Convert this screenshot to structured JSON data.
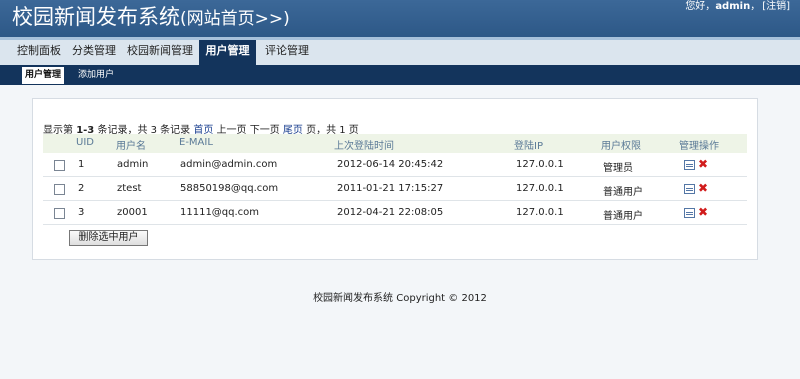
{
  "header": {
    "title": "校园新闻发布系统",
    "home_link": "(网站首页>>)",
    "greeting": "您好，",
    "username": "admin",
    "greeting_suffix": "，",
    "logout": "[注销]"
  },
  "nav": {
    "tabs": [
      {
        "label": "控制面板"
      },
      {
        "label": "分类管理"
      },
      {
        "label": "校园新闻管理"
      },
      {
        "label": "用户管理",
        "active": true
      },
      {
        "label": "评论管理"
      }
    ]
  },
  "subnav": {
    "tabs": [
      {
        "label": "用户管理",
        "active": true
      },
      {
        "label": "添加用户"
      }
    ]
  },
  "summary": {
    "prefix": "显示第 ",
    "range": "1-3",
    "middle": " 条记录，共 3 条记录 ",
    "first": "首页",
    "prev": " 上一页 下一页 ",
    "last": "尾页",
    "suffix": " 页，共 1 页"
  },
  "table": {
    "headers": [
      "UID",
      "用户名",
      "E-MAIL",
      "上次登陆时间",
      "登陆IP",
      "用户权限",
      "管理操作"
    ],
    "rows": [
      {
        "uid": "1",
        "username": "admin",
        "email": "admin@admin.com",
        "last_login": "2012-06-14 20:45:42",
        "ip": "127.0.0.1",
        "role": "管理员"
      },
      {
        "uid": "2",
        "username": "ztest",
        "email": "58850198@qq.com",
        "last_login": "2011-01-21 17:15:27",
        "ip": "127.0.0.1",
        "role": "普通用户"
      },
      {
        "uid": "3",
        "username": "z0001",
        "email": "11111@qq.com",
        "last_login": "2012-04-21 22:08:05",
        "ip": "127.0.0.1",
        "role": "普通用户"
      }
    ]
  },
  "actions": {
    "delete_selected": "删除选中用户"
  },
  "footer": {
    "copyright": "校园新闻发布系统 Copyright © 2012"
  },
  "colors": {
    "header_bg": "#2d5887",
    "nav_active_bg": "#13345c",
    "table_header_bg": "#eef4e7",
    "delete_icon": "#d11c1c"
  }
}
